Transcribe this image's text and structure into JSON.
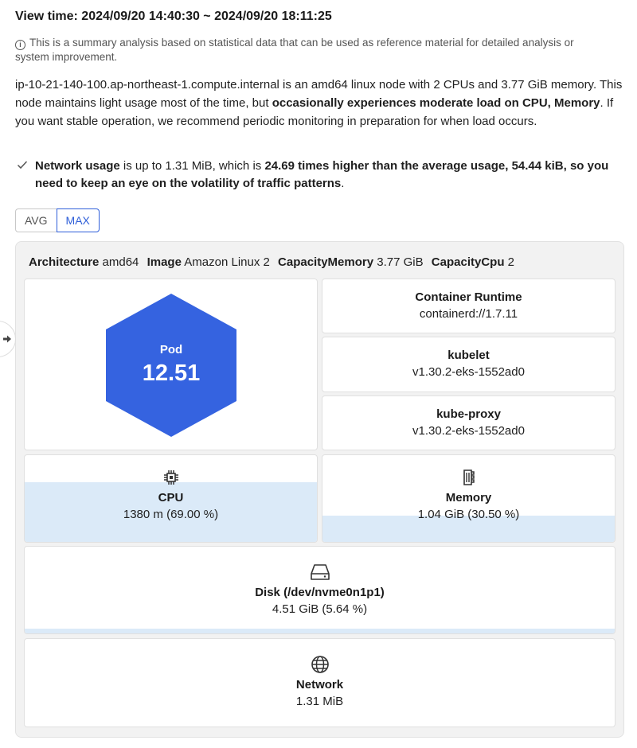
{
  "view_time": "View time: 2024/09/20 14:40:30 ~ 2024/09/20 18:11:25",
  "info_text": "This is a summary analysis based on statistical data that can be used as reference material for detailed analysis or system improvement.",
  "summary": {
    "part1": "ip-10-21-140-100.ap-northeast-1.compute.internal is an amd64 linux node with 2 CPUs and 3.77 GiB memory. This node maintains light usage most of the time, but ",
    "bold": "occasionally experiences moderate load on CPU, Memory",
    "part2": ". If you want stable operation, we recommend periodic monitoring in preparation for when load occurs."
  },
  "insight": {
    "bold1": "Network usage",
    "text1": " is up to 1.31 MiB, which is ",
    "bold2": "24.69 times higher than the average usage, 54.44 kiB, so you need to keep an eye on the volatility of traffic patterns",
    "text2": "."
  },
  "toggle": {
    "avg": "AVG",
    "max": "MAX",
    "selected": "MAX"
  },
  "attributes": [
    {
      "key": "Architecture",
      "value": "amd64"
    },
    {
      "key": "Image",
      "value": "Amazon Linux 2"
    },
    {
      "key": "CapacityMemory",
      "value": "3.77 GiB"
    },
    {
      "key": "CapacityCpu",
      "value": "2"
    }
  ],
  "pod": {
    "label": "Pod",
    "value": "12.51",
    "color": "#3563e0"
  },
  "versions": [
    {
      "label": "Container Runtime",
      "value": "containerd://1.7.11"
    },
    {
      "label": "kubelet",
      "value": "v1.30.2-eks-1552ad0"
    },
    {
      "label": "kube-proxy",
      "value": "v1.30.2-eks-1552ad0"
    }
  ],
  "resources": {
    "cpu": {
      "icon": "cpu-icon",
      "label": "CPU",
      "value": "1380 m (69.00 %)",
      "usage": 0.69
    },
    "memory": {
      "icon": "memory-icon",
      "label": "Memory",
      "value": "1.04 GiB (30.50 %)",
      "usage": 0.305
    },
    "disk": {
      "icon": "disk-icon",
      "label": "Disk (/dev/nvme0n1p1)",
      "value": "4.51 GiB (5.64 %)",
      "usage": 0.0564
    },
    "network": {
      "icon": "globe-icon",
      "label": "Network",
      "value": "1.31 MiB"
    }
  },
  "colors": {
    "accent": "#2f5fd9",
    "usage_fill": "#dbeaf8",
    "panel_bg": "#f2f2f2"
  }
}
